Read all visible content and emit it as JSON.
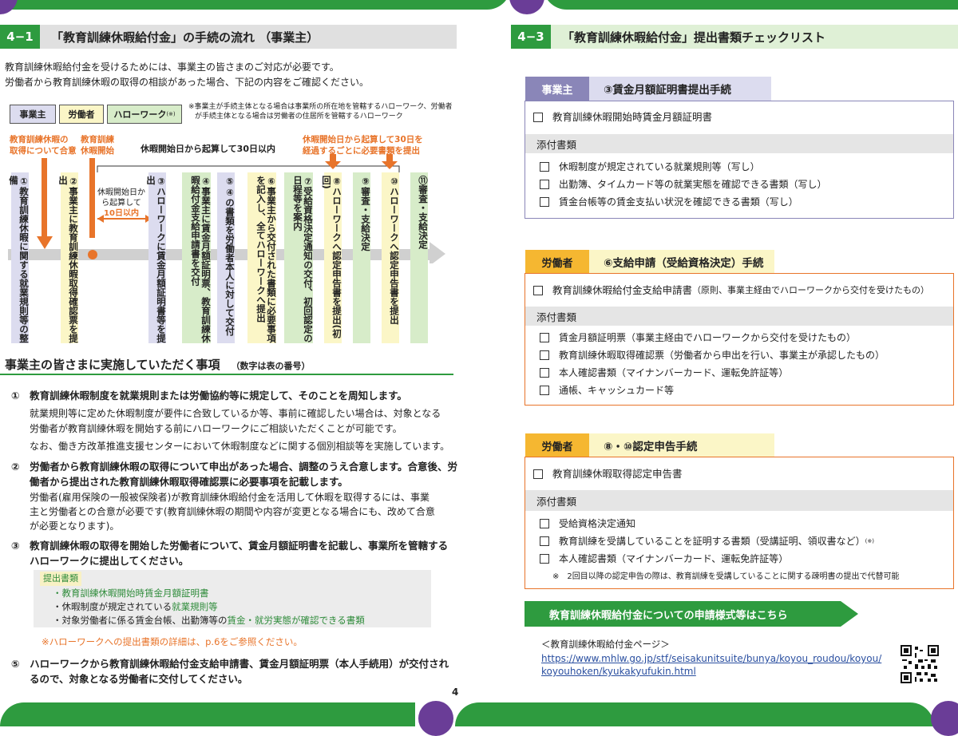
{
  "left": {
    "section_num": "4−1",
    "section_title": "「教育訓練休暇給付金」の手続の流れ （事業主）",
    "intro1": "教育訓練休暇給付金を受けるためには、事業主の皆さまのご対応が必要です。",
    "intro2": "労働者から教育訓練休暇の取得の相談があった場合、下記の内容をご確認ください。",
    "roles": [
      "事業主",
      "労働者",
      "ハローワーク"
    ],
    "role_hw_sup": "(※)",
    "role_note1": "※事業主が手続主体となる場合は事業所の所在地を管轄するハローワーク、労働者",
    "role_note2": "が手続主体となる場合は労働者の住居所を管轄するハローワーク",
    "label_agree1": "教育訓練休暇の",
    "label_agree2": "取得について合意",
    "label_start1": "教育訓練",
    "label_start2": "休暇開始",
    "label_30days": "休暇開始日から起算して30日以内",
    "label_10days1": "休暇開始日か",
    "label_10days2": "ら起算して",
    "label_10days3": "10日以内",
    "label_every1": "休暇開始日から起算して30日を",
    "label_every2": "経過するごとに必要書類を提出",
    "steps": [
      "①教育訓練休暇に関する就業規則等の整備",
      "②事業主に教育訓練休暇取得確認票を提出",
      "③ハローワークに賃金月額証明書等を提出",
      "④事業主に賃金月額証明票、教育訓練休暇給付金支給申請書を交付",
      "⑤④の書類を労働者本人に対して交付",
      "⑥事業主から交付された書類に必要事項を記入し、全てハローワークへ提出",
      "⑦受給資格決定通知の交付、初回認定の日程等を案内",
      "⑧ハローワークへ認定申告書を提出(初回)",
      "⑨審査・支給決定",
      "⑩ハローワークへ認定申告書を提出",
      "⑪審査・支給決定"
    ],
    "sub_heading": "事業主の皆さまに実施していただく事項",
    "sub_heading_note": "（数字は表の番号）",
    "item1_head": "①　教育訓練休暇制度を就業規則または労働協約等に規定して、そのことを周知します。",
    "item1_b1": "就業規則等に定めた休暇制度が要件に合致しているか等、事前に確認したい場合は、対象となる",
    "item1_b2": "労働者が教育訓練休暇を開始する前にハローワークにご相談いただくことが可能です。",
    "item1_b3": "なお、働き方改革推進支援センターにおいて休暇制度などに関する個別相談等を実施しています。",
    "item2_head1": "②　労働者から教育訓練休暇の取得について申出があった場合、調整のうえ合意します。合意後、労",
    "item2_head2": "働者から提出された教育訓練休暇取得確認票に必要事項を記載します。",
    "item2_b1": "労働者(雇用保険の一般被保険者)が教育訓練休暇給付金を活用して休暇を取得するには、事業",
    "item2_b2": "主と労働者との合意が必要です(教育訓練休暇の期間や内容が変更となる場合にも、改めて合意",
    "item2_b3": "が必要となります)。",
    "item3_head1": "③　教育訓練休暇の取得を開始した労働者について、賃金月額証明書を記載し、事業所を管轄する",
    "item3_head2": "ハローワークに提出してください。",
    "submit_label": "提出書類",
    "submit1": "・教育訓練休暇開始時賃金月額証明書",
    "submit2a": "・休暇制度が規定されている",
    "submit2b": "就業規則等",
    "submit3a": "・対象労働者に係る賃金台帳、出勤簿等の",
    "submit3b": "賃金・就労実態が確認できる書類",
    "submit_note": "※ハローワークへの提出書類の詳細は、p.6をご参照ください。",
    "item5_head1": "⑤　ハローワークから教育訓練休暇給付金支給申請書、賃金月額証明票（本人手続用）が交付され",
    "item5_head2": "るので、対象となる労働者に交付してください。",
    "page_num": "4"
  },
  "right": {
    "section_num": "4−3",
    "section_title": "「教育訓練休暇給付金」提出書類チェックリスト",
    "block1": {
      "tag": "事業主",
      "title": "③賃金月額証明書提出手続",
      "main": "教育訓練休暇開始時賃金月額証明書",
      "attach": "添付書類",
      "items": [
        "休暇制度が規定されている就業規則等（写し）",
        "出勤簿、タイムカード等の就業実態を確認できる書類（写し）",
        "賃金台帳等の賃金支払い状況を確認できる書類（写し）"
      ]
    },
    "block2": {
      "tag": "労働者",
      "title": "⑥支給申請（受給資格決定）手続",
      "main": "教育訓練休暇給付金支給申請書",
      "main_note": "（原則、事業主経由でハローワークから交付を受けたもの）",
      "attach": "添付書類",
      "items": [
        "賃金月額証明票（事業主経由でハローワークから交付を受けたもの）",
        "教育訓練休暇取得確認票（労働者から申出を行い、事業主が承認したもの）",
        "本人確認書類（マイナンバーカード、運転免許証等）",
        "通帳、キャッシュカード等"
      ]
    },
    "block3": {
      "tag": "労働者",
      "title": "⑧・⑩認定申告手続",
      "main": "教育訓練休暇取得認定申告書",
      "attach": "添付書類",
      "items": [
        "受給資格決定通知",
        "教育訓練を受講していることを証明する書類（受講証明、領収書など）",
        "本人確認書類（マイナンバーカード、運転免許証等）"
      ],
      "item2_sup": "(※)",
      "note": "※　2回目以降の認定申告の際は、教育訓練を受講していることに関する疎明書の提出で代替可能"
    },
    "banner": "教育訓練休暇給付金についての申請様式等はこちら",
    "page_label": "＜教育訓練休暇給付金ページ＞",
    "url1": "https://www.mhlw.go.jp/stf/seisakunitsuite/bunya/koyou_roudou/koyou/",
    "url2": "koyouhoken/kyukakyufukin.html"
  },
  "colors": {
    "green": "#2e9b3f",
    "purple": "#6a3d97",
    "orange": "#e8742a",
    "yellow_tag": "#f5b731",
    "lavender": "#dcdcef"
  }
}
